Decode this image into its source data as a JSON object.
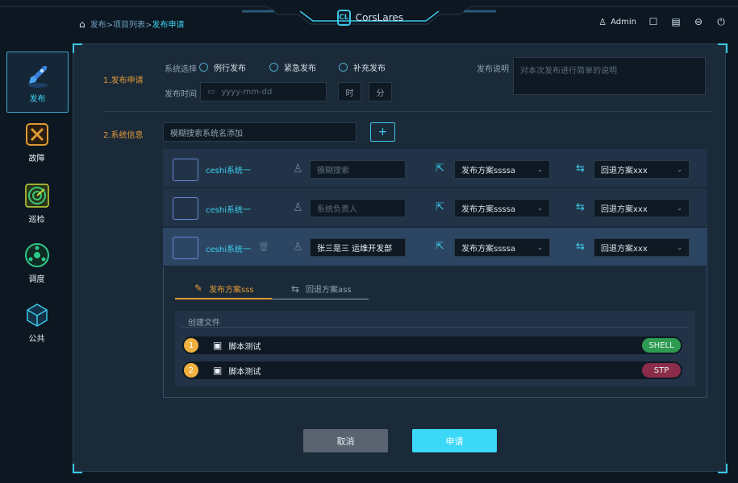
{
  "breadcrumb": {
    "path": "发布>项目列表>",
    "current": "发布申请"
  },
  "brand": {
    "name": "CorsLares",
    "logo_text": "CL"
  },
  "header": {
    "user": "Admin",
    "icons": [
      "chat-icon",
      "document-icon",
      "settings-icon",
      "power-icon"
    ]
  },
  "nav": [
    {
      "label": "发布",
      "icon": "rocket-icon",
      "active": true
    },
    {
      "label": "故障",
      "icon": "tools-icon",
      "active": false
    },
    {
      "label": "巡检",
      "icon": "radar-icon",
      "active": false
    },
    {
      "label": "调度",
      "icon": "schedule-icon",
      "active": false
    },
    {
      "label": "公共",
      "icon": "cube-icon",
      "active": false
    }
  ],
  "section1": {
    "title": "1.发布申请",
    "type_label": "系统选择",
    "types": [
      "例行发布",
      "紧急发布",
      "补充发布"
    ],
    "time_label": "发布时间",
    "date_placeholder": "yyyy-mm-dd",
    "hour_label": "时",
    "minute_label": "分",
    "desc_label": "发布说明",
    "desc_placeholder": "对本次发布进行简单的说明"
  },
  "section2": {
    "title": "2.系统信息",
    "search_placeholder": "模糊搜索系统名添加",
    "add_label": "+"
  },
  "systems": [
    {
      "name": "ceshi系统一",
      "owner_placeholder": "模糊搜索",
      "owner_value": "",
      "plan": "发布方案ssssa",
      "rollback": "回退方案xxx"
    },
    {
      "name": "ceshi系统一",
      "owner_placeholder": "系统负责人",
      "owner_value": "",
      "plan": "发布方案ssssa",
      "rollback": "回退方案xxx"
    },
    {
      "name": "ceshi系统一",
      "owner_placeholder": "",
      "owner_value": "张三是三    运维开发部",
      "plan": "发布方案ssssa",
      "rollback": "回退方案xxx"
    }
  ],
  "detail": {
    "tabs": [
      "发布方案sss",
      "回退方案ass"
    ],
    "section_title": "创建文件",
    "files": [
      {
        "index": "1",
        "name": "脚本测试",
        "type": "SHELL",
        "color": "#2e9b52"
      },
      {
        "index": "2",
        "name": "脚本测试",
        "type": "STP",
        "color": "#8b2c4a"
      }
    ]
  },
  "actions": {
    "cancel": "取消",
    "submit": "申请"
  }
}
